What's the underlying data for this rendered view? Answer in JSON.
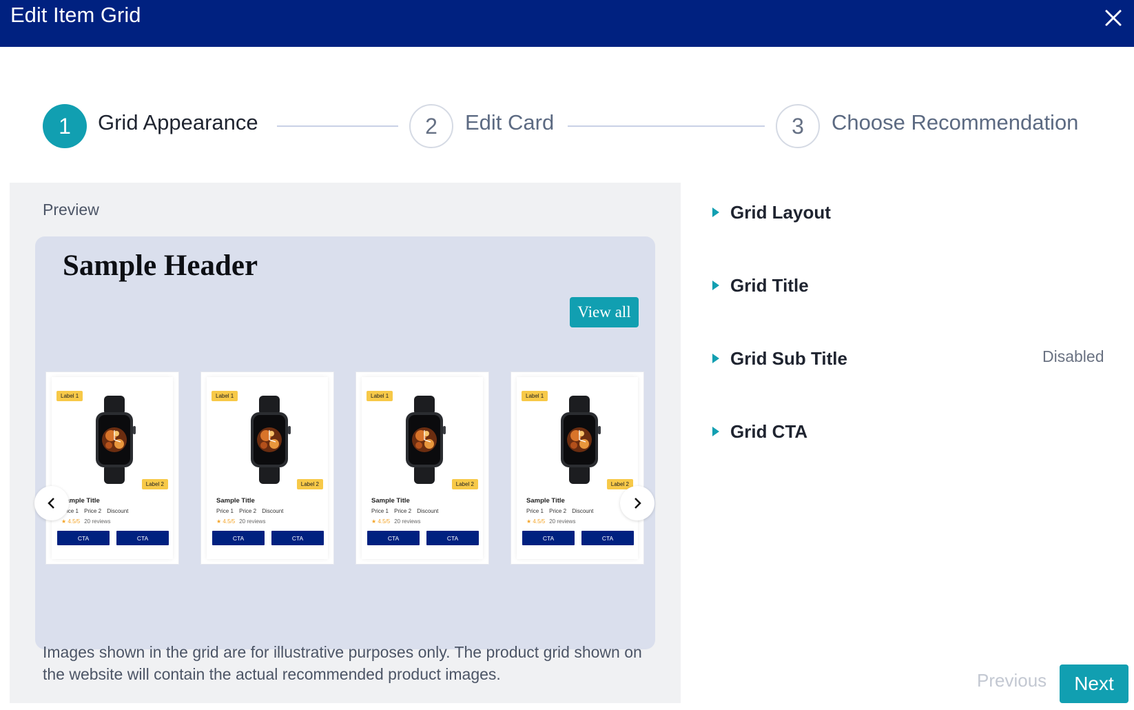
{
  "modal": {
    "title": "Edit Item Grid"
  },
  "stepper": {
    "steps": [
      {
        "number": "1",
        "label": "Grid Appearance"
      },
      {
        "number": "2",
        "label": "Edit Card"
      },
      {
        "number": "3",
        "label": "Choose Recommendation"
      }
    ]
  },
  "preview": {
    "label": "Preview",
    "grid": {
      "header": "Sample Header",
      "view_all": "View all",
      "cards": [
        {
          "label1": "Label 1",
          "label2": "Label 2",
          "title": "Sample Title",
          "price1": "Price 1",
          "price2": "Price 2",
          "discount": "Discount",
          "rating": "4.5/5",
          "reviews": "20 reviews",
          "cta1": "CTA",
          "cta2": "CTA"
        },
        {
          "label1": "Label 1",
          "label2": "Label 2",
          "title": "Sample Title",
          "price1": "Price 1",
          "price2": "Price 2",
          "discount": "Discount",
          "rating": "4.5/5",
          "reviews": "20 reviews",
          "cta1": "CTA",
          "cta2": "CTA"
        },
        {
          "label1": "Label 1",
          "label2": "Label 2",
          "title": "Sample Title",
          "price1": "Price 1",
          "price2": "Price 2",
          "discount": "Discount",
          "rating": "4.5/5",
          "reviews": "20 reviews",
          "cta1": "CTA",
          "cta2": "CTA"
        },
        {
          "label1": "Label 1",
          "label2": "Label 2",
          "title": "Sample Title",
          "price1": "Price 1",
          "price2": "Price 2",
          "discount": "Discount",
          "rating": "4.5/5",
          "reviews": "20 reviews",
          "cta1": "CTA",
          "cta2": "CTA"
        }
      ]
    },
    "disclaimer": "Images shown in the grid are for illustrative purposes only. The product grid shown on the website will contain the actual recommended product images."
  },
  "settings": {
    "sections": [
      {
        "label": "Grid Layout",
        "status": ""
      },
      {
        "label": "Grid Title",
        "status": ""
      },
      {
        "label": "Grid Sub Title",
        "status": "Disabled"
      },
      {
        "label": "Grid CTA",
        "status": ""
      }
    ]
  },
  "footer": {
    "previous": "Previous",
    "next": "Next"
  },
  "colors": {
    "header": "#002180",
    "accent": "#119fb1",
    "cta": "#002180",
    "badge": "#f7c948"
  }
}
